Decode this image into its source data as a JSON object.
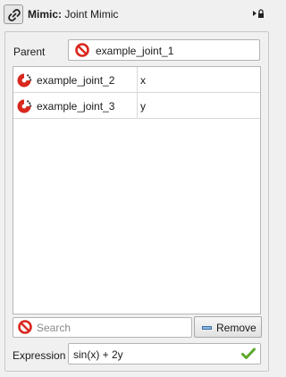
{
  "header": {
    "title_bold": "Mimic:",
    "title_rest": " Joint Mimic",
    "icon": "link-icon",
    "pin_icon": "pin-lock-icon"
  },
  "parent": {
    "label": "Parent",
    "value": "example_joint_1",
    "icon": "no-entry-icon"
  },
  "table": {
    "rows": [
      {
        "name": "example_joint_2",
        "expression": "x",
        "icon": "joint-icon"
      },
      {
        "name": "example_joint_3",
        "expression": "y",
        "icon": "joint-icon"
      }
    ]
  },
  "search": {
    "placeholder": "Search",
    "value": "",
    "icon": "no-entry-icon"
  },
  "remove_button": {
    "label": "Remove",
    "icon": "minus-icon"
  },
  "expression": {
    "label": "Expression",
    "value": "sin(x) + 2y",
    "status_icon": "checkmark-icon"
  },
  "colors": {
    "no_entry_red": "#d9281e",
    "check_green": "#5aa82a",
    "minus_blue": "#8fb6de"
  }
}
